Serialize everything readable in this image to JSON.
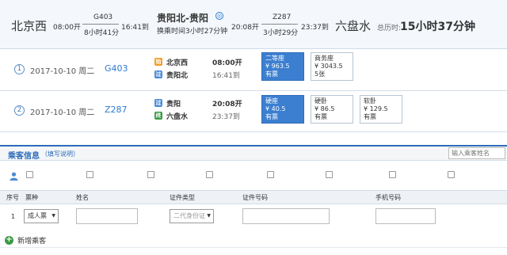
{
  "summary": {
    "from_station": "北京西",
    "leg1": {
      "depart_time": "08:00开",
      "train": "G403",
      "duration": "8小时41分",
      "arrive_time": "16:41到"
    },
    "transfer_station": "贵阳北-贵阳",
    "transfer_note": "换乘时间3小时27分钟",
    "leg2": {
      "depart_time": "20:08开",
      "train": "Z287",
      "duration": "3小时29分",
      "arrive_time": "23:37到"
    },
    "to_station": "六盘水",
    "total_label": "总历时:",
    "total_value": "15小时37分钟"
  },
  "trips": [
    {
      "index": "1",
      "date": "2017-10-10 周二",
      "train": "G403",
      "from_icon": "始",
      "from_station": "北京西",
      "from_time": "08:00开",
      "to_icon": "过",
      "to_station": "贵阳北",
      "to_time": "16:41到",
      "seats": [
        {
          "type": "二等座",
          "price": "¥ 963.5",
          "avail": "有票",
          "selected": true
        },
        {
          "type": "商务座",
          "price": "¥ 3043.5",
          "avail": "5张",
          "selected": false
        }
      ]
    },
    {
      "index": "2",
      "date": "2017-10-10 周二",
      "train": "Z287",
      "from_icon": "过",
      "from_station": "贵阳",
      "from_time": "20:08开",
      "to_icon": "终",
      "to_station": "六盘水",
      "to_time": "23:37到",
      "seats": [
        {
          "type": "硬座",
          "price": "¥ 40.5",
          "avail": "有票",
          "selected": true
        },
        {
          "type": "硬卧",
          "price": "¥ 86.5",
          "avail": "有票",
          "selected": false
        },
        {
          "type": "软卧",
          "price": "¥ 129.5",
          "avail": "有票",
          "selected": false
        }
      ]
    }
  ],
  "passenger": {
    "section_title": "乘客信息",
    "fill_hint": "（填写说明）",
    "search_placeholder": "输入乘客姓名",
    "columns": {
      "seq": "序号",
      "ticket_type": "票种",
      "name": "姓名",
      "id_type": "证件类型",
      "id_number": "证件号码",
      "phone": "手机号码"
    },
    "row": {
      "seq": "1",
      "ticket_type": "成人票",
      "id_type": "二代身份证"
    },
    "add_label": "新增乘客"
  },
  "colors": {
    "accent": "#2d6cb8",
    "selected_seat": "#3c7fd0",
    "start_icon": "#f29c1f",
    "pass_icon": "#4a8bd4",
    "end_icon": "#3a9a45"
  }
}
